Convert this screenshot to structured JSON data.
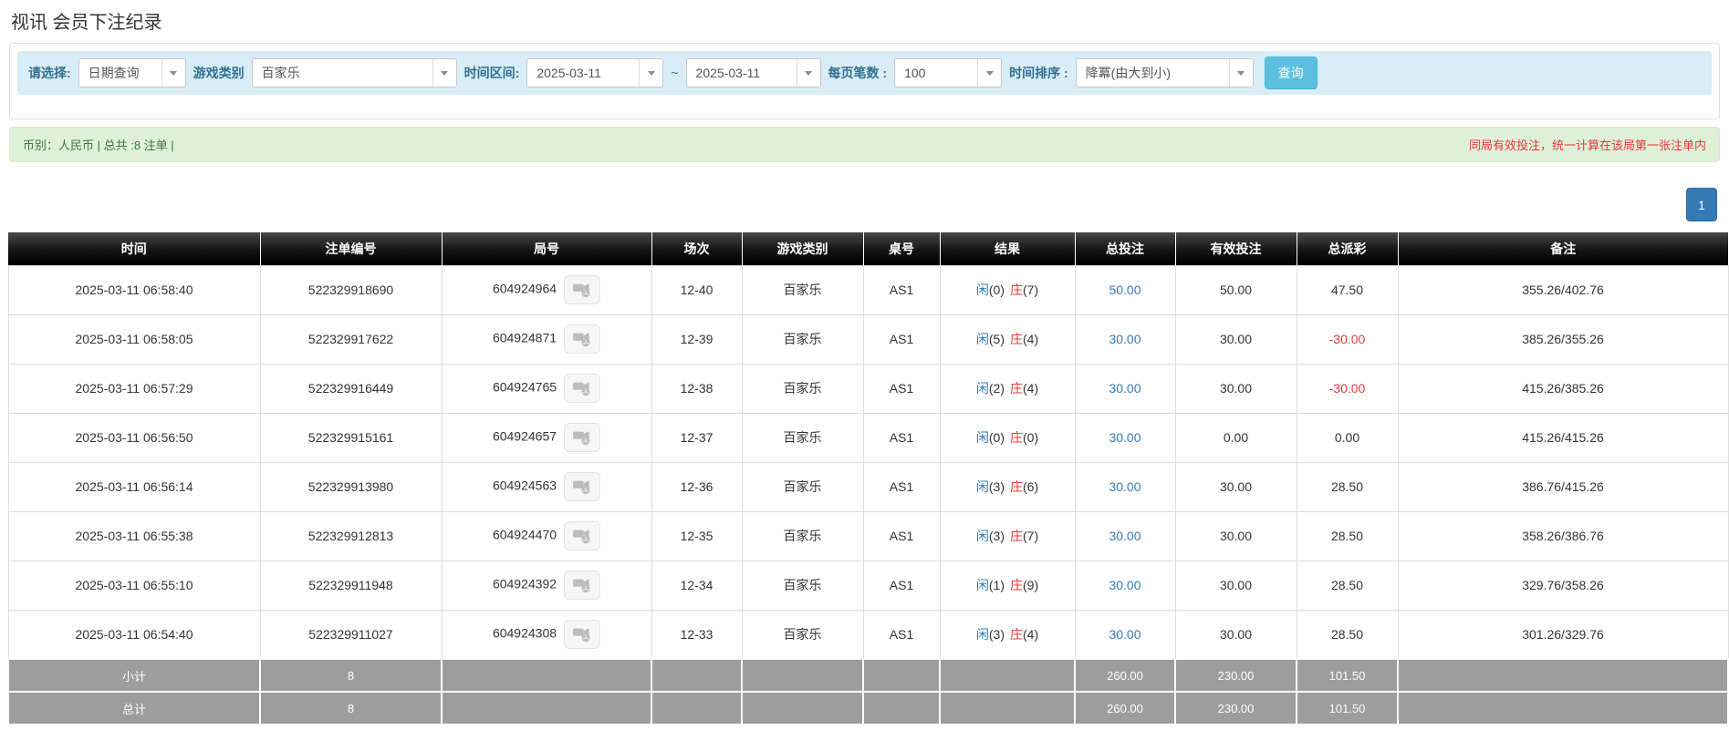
{
  "page": {
    "title": "视讯 会员下注纪录"
  },
  "filters": {
    "select_label": "请选择:",
    "select_value": "日期查询",
    "game_type_label": "游戏类别",
    "game_type_value": "百家乐",
    "time_range_label": "时间区间:",
    "date_from": "2025-03-11",
    "date_sep": "~",
    "date_to": "2025-03-11",
    "page_size_label": "每页笔数 :",
    "page_size_value": "100",
    "sort_label": "时间排序 :",
    "sort_value": "降冪(由大到小)",
    "search_button": "查询"
  },
  "summary": {
    "left": "币别：人民币 | 总共 :8 注单 |",
    "right": "同局有效投注，统一计算在该局第一张注单内"
  },
  "pagination": {
    "current": "1"
  },
  "table": {
    "headers": [
      "时间",
      "注单编号",
      "局号",
      "场次",
      "游戏类别",
      "桌号",
      "结果",
      "总投注",
      "有效投注",
      "总派彩",
      "备注"
    ],
    "result_labels": {
      "player": "闲",
      "banker": "庄"
    },
    "rows": [
      {
        "time": "2025-03-11 06:58:40",
        "bet_id": "522329918690",
        "round_id": "604924964",
        "session": "12-40",
        "game": "百家乐",
        "table_no": "AS1",
        "result_p": "(0)",
        "result_b": "(7)",
        "total_bet": "50.00",
        "valid_bet": "50.00",
        "payout": "47.50",
        "remark": "355.26/402.76"
      },
      {
        "time": "2025-03-11 06:58:05",
        "bet_id": "522329917622",
        "round_id": "604924871",
        "session": "12-39",
        "game": "百家乐",
        "table_no": "AS1",
        "result_p": "(5)",
        "result_b": "(4)",
        "total_bet": "30.00",
        "valid_bet": "30.00",
        "payout": "-30.00",
        "remark": "385.26/355.26"
      },
      {
        "time": "2025-03-11 06:57:29",
        "bet_id": "522329916449",
        "round_id": "604924765",
        "session": "12-38",
        "game": "百家乐",
        "table_no": "AS1",
        "result_p": "(2)",
        "result_b": "(4)",
        "total_bet": "30.00",
        "valid_bet": "30.00",
        "payout": "-30.00",
        "remark": "415.26/385.26"
      },
      {
        "time": "2025-03-11 06:56:50",
        "bet_id": "522329915161",
        "round_id": "604924657",
        "session": "12-37",
        "game": "百家乐",
        "table_no": "AS1",
        "result_p": "(0)",
        "result_b": "(0)",
        "total_bet": "30.00",
        "valid_bet": "0.00",
        "payout": "0.00",
        "remark": "415.26/415.26"
      },
      {
        "time": "2025-03-11 06:56:14",
        "bet_id": "522329913980",
        "round_id": "604924563",
        "session": "12-36",
        "game": "百家乐",
        "table_no": "AS1",
        "result_p": "(3)",
        "result_b": "(6)",
        "total_bet": "30.00",
        "valid_bet": "30.00",
        "payout": "28.50",
        "remark": "386.76/415.26"
      },
      {
        "time": "2025-03-11 06:55:38",
        "bet_id": "522329912813",
        "round_id": "604924470",
        "session": "12-35",
        "game": "百家乐",
        "table_no": "AS1",
        "result_p": "(3)",
        "result_b": "(7)",
        "total_bet": "30.00",
        "valid_bet": "30.00",
        "payout": "28.50",
        "remark": "358.26/386.76"
      },
      {
        "time": "2025-03-11 06:55:10",
        "bet_id": "522329911948",
        "round_id": "604924392",
        "session": "12-34",
        "game": "百家乐",
        "table_no": "AS1",
        "result_p": "(1)",
        "result_b": "(9)",
        "total_bet": "30.00",
        "valid_bet": "30.00",
        "payout": "28.50",
        "remark": "329.76/358.26"
      },
      {
        "time": "2025-03-11 06:54:40",
        "bet_id": "522329911027",
        "round_id": "604924308",
        "session": "12-33",
        "game": "百家乐",
        "table_no": "AS1",
        "result_p": "(3)",
        "result_b": "(4)",
        "total_bet": "30.00",
        "valid_bet": "30.00",
        "payout": "28.50",
        "remark": "301.26/329.76"
      }
    ],
    "subtotal": {
      "label": "小计",
      "count": "8",
      "total_bet": "260.00",
      "valid_bet": "230.00",
      "payout": "101.50"
    },
    "grand_total": {
      "label": "总计",
      "count": "8",
      "total_bet": "260.00",
      "valid_bet": "230.00",
      "payout": "101.50"
    }
  },
  "colors": {
    "filter_bg": "#d9edf7",
    "filter_label": "#31708f",
    "query_button": "#5bc0de",
    "success_bg": "#dff0d8",
    "success_text": "#3c763d",
    "warning_red": "#e4393c",
    "link_blue": "#337ab7",
    "pager_blue": "#337ab7",
    "header_black": "#141414",
    "total_grey": "#9d9d9d"
  }
}
